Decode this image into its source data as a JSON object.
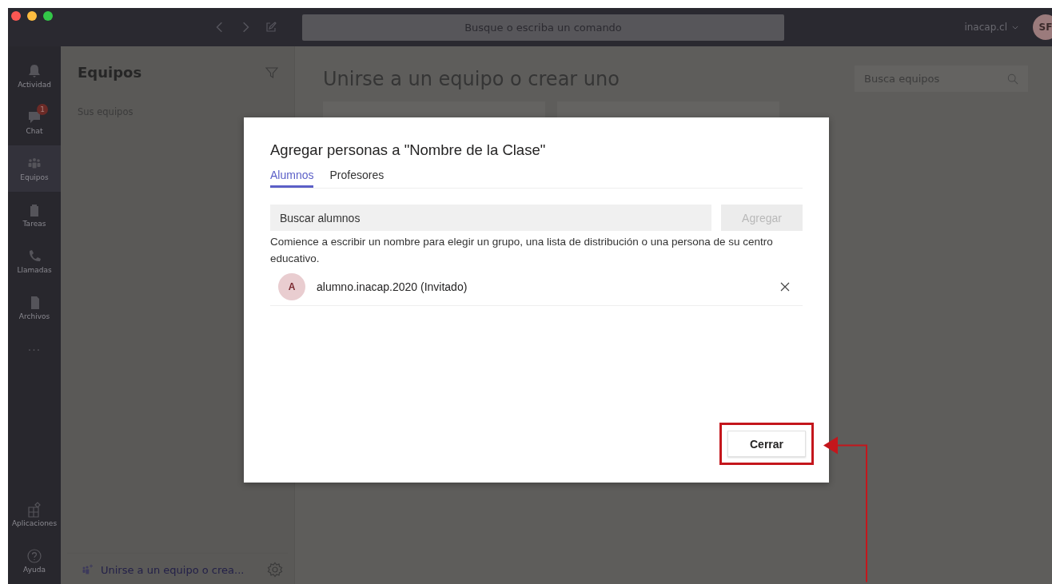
{
  "title_bar": {
    "search_placeholder": "Busque o escriba un comando",
    "account": "inacap.cl",
    "avatar_initials": "SF"
  },
  "rail": {
    "items": [
      {
        "label": "Actividad",
        "selected": false
      },
      {
        "label": "Chat",
        "selected": false,
        "badge": "1"
      },
      {
        "label": "Equipos",
        "selected": true
      },
      {
        "label": "Tareas",
        "selected": false
      },
      {
        "label": "Llamadas",
        "selected": false
      },
      {
        "label": "Archivos",
        "selected": false
      }
    ],
    "more": "...",
    "bottom_items": [
      {
        "label": "Aplicaciones"
      },
      {
        "label": "Ayuda"
      }
    ]
  },
  "teams_panel": {
    "title": "Equipos",
    "section": "Sus equipos",
    "footer_link": "Unirse a un equipo o crea..."
  },
  "main": {
    "heading": "Unirse a un equipo o crear uno",
    "search_placeholder": "Busca equipos"
  },
  "dialog": {
    "title": "Agregar personas a \"Nombre de la Clase\"",
    "tabs": [
      {
        "label": "Alumnos",
        "selected": true
      },
      {
        "label": "Profesores",
        "selected": false
      }
    ],
    "search": {
      "placeholder": "Buscar alumnos"
    },
    "add_button": {
      "label": "Agregar",
      "disabled": true
    },
    "hint": "Comience a escribir un nombre para elegir un grupo, una lista de distribución o una persona de su centro educativo.",
    "members": [
      {
        "initial": "A",
        "name": "alumno.inacap.2020 (Invitado)"
      }
    ],
    "close_button": {
      "label": "Cerrar",
      "highlighted": true
    }
  }
}
